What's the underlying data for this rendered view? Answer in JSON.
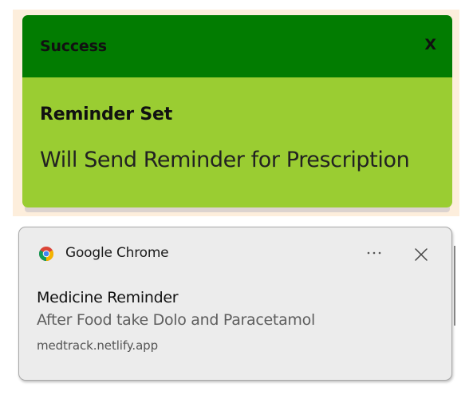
{
  "success_toast": {
    "header_title": "Success",
    "close_label": "X",
    "body_heading": "Reminder Set",
    "body_text": "Will Send Reminder for Prescription",
    "colors": {
      "header_bg": "#027c01",
      "body_bg": "#9acd32",
      "backdrop": "#fdeedc"
    }
  },
  "chrome_notification": {
    "app_icon": "chrome-logo-icon",
    "app_name": "Google Chrome",
    "more_icon": "more-options-icon",
    "close_icon": "close-icon",
    "title": "Medicine Reminder",
    "message": "After Food take Dolo and Paracetamol",
    "source": "medtrack.netlify.app",
    "colors": {
      "background": "#ececec",
      "border": "#a8a8a8"
    }
  }
}
